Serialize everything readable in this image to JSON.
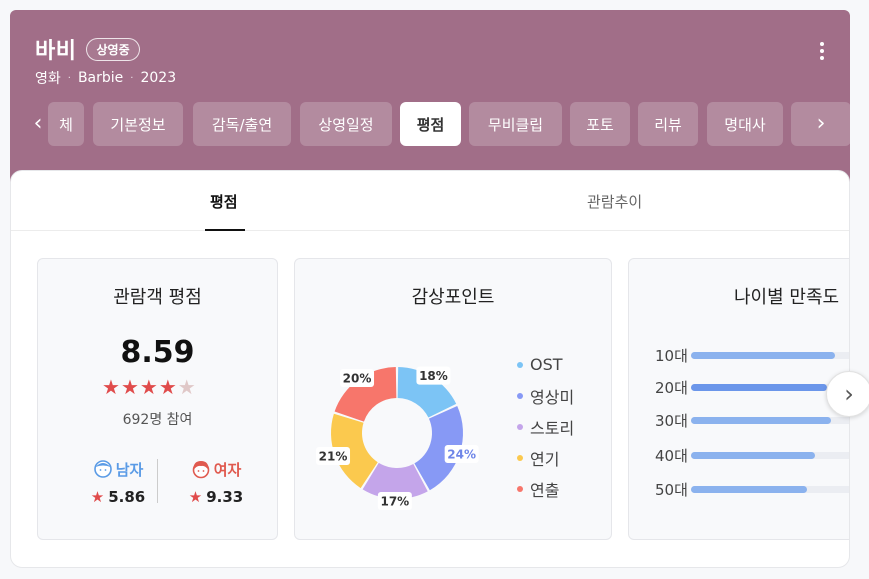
{
  "header": {
    "title": "바비",
    "badge": "상영중",
    "meta": [
      "영화",
      "Barbie",
      "2023"
    ],
    "background_color": "#a16e88"
  },
  "tabs": [
    {
      "label": "체",
      "active": false
    },
    {
      "label": "기본정보",
      "active": false
    },
    {
      "label": "감독/출연",
      "active": false
    },
    {
      "label": "상영일정",
      "active": false
    },
    {
      "label": "평점",
      "active": true
    },
    {
      "label": "무비클립",
      "active": false
    },
    {
      "label": "포토",
      "active": false
    },
    {
      "label": "리뷰",
      "active": false
    },
    {
      "label": "명대사",
      "active": false
    }
  ],
  "subtabs": [
    {
      "label": "평점",
      "active": true
    },
    {
      "label": "관람추이",
      "active": false
    }
  ],
  "audience_rating": {
    "title": "관람객 평점",
    "score": "8.59",
    "stars": 4.3,
    "participants": "692명 참여",
    "male": {
      "label": "남자",
      "score": "5.86",
      "color": "#5a9be6"
    },
    "female": {
      "label": "여자",
      "score": "9.33",
      "color": "#e05a4f"
    }
  },
  "viewing_points": {
    "title": "감상포인트",
    "chart_data": {
      "type": "pie",
      "categories": [
        "OST",
        "영상미",
        "스토리",
        "연기",
        "연출"
      ],
      "values": [
        18,
        24,
        17,
        21,
        20
      ],
      "value_labels": [
        "18%",
        "24%",
        "17%",
        "21%",
        "20%"
      ],
      "colors": [
        "#7cc4f5",
        "#8799f5",
        "#c4a5ea",
        "#fbc94e",
        "#f7766b"
      ],
      "legend_position": "right"
    }
  },
  "age_satisfaction": {
    "title": "나이별 만족도",
    "chart_data": {
      "type": "bar",
      "orientation": "horizontal",
      "categories": [
        "10대",
        "20대",
        "30대",
        "40대",
        "50대"
      ],
      "values": [
        0.72,
        0.68,
        0.7,
        0.62,
        0.58
      ],
      "colors": [
        "#8bb2ee",
        "#6b96ea",
        "#8bb2ee",
        "#8bb2ee",
        "#8bb2ee"
      ]
    }
  }
}
